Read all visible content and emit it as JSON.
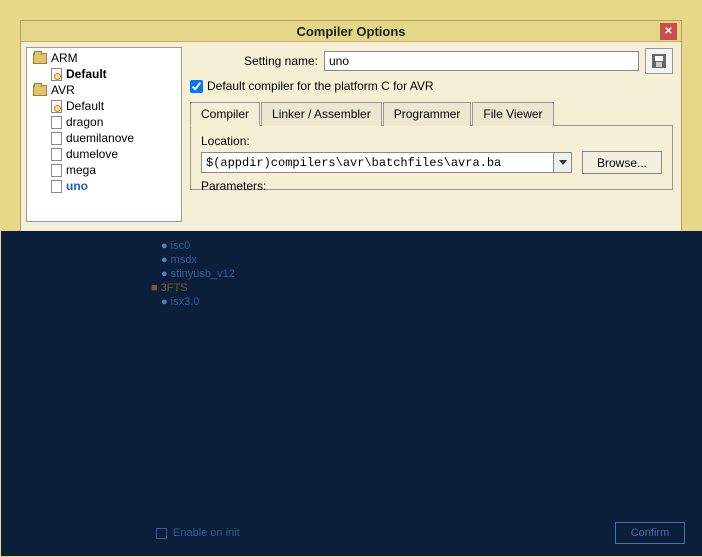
{
  "window": {
    "title": "Compiler Options"
  },
  "tree": {
    "arm": "ARM",
    "arm_default": "Default",
    "avr": "AVR",
    "avr_default": "Default",
    "avr_dragon": "dragon",
    "avr_duemilanove": "duemilanove",
    "avr_dumelove": "dumelove",
    "avr_mega": "mega",
    "avr_uno": "uno"
  },
  "form": {
    "setting_name_label": "Setting name:",
    "setting_name_value": "uno",
    "default_checkbox_label": "Default compiler for the platform C for AVR",
    "default_checked": true
  },
  "tabs": {
    "compiler": "Compiler",
    "linker": "Linker / Assembler",
    "programmer": "Programmer",
    "viewer": "File Viewer"
  },
  "compiler_tab": {
    "location_label": "Location:",
    "location_value": "$(appdir)compilers\\avr\\batchfiles\\avra.ba",
    "browse_label": "Browse...",
    "parameters_label": "Parameters:"
  },
  "dark": {
    "items": {
      "a": "isc0",
      "b": "msdx",
      "c": "stinyusb_v12",
      "d_parent": "3FTS",
      "d": "isx3.0"
    },
    "checkbox_label": "Enable on init",
    "ok": "Confirm"
  }
}
